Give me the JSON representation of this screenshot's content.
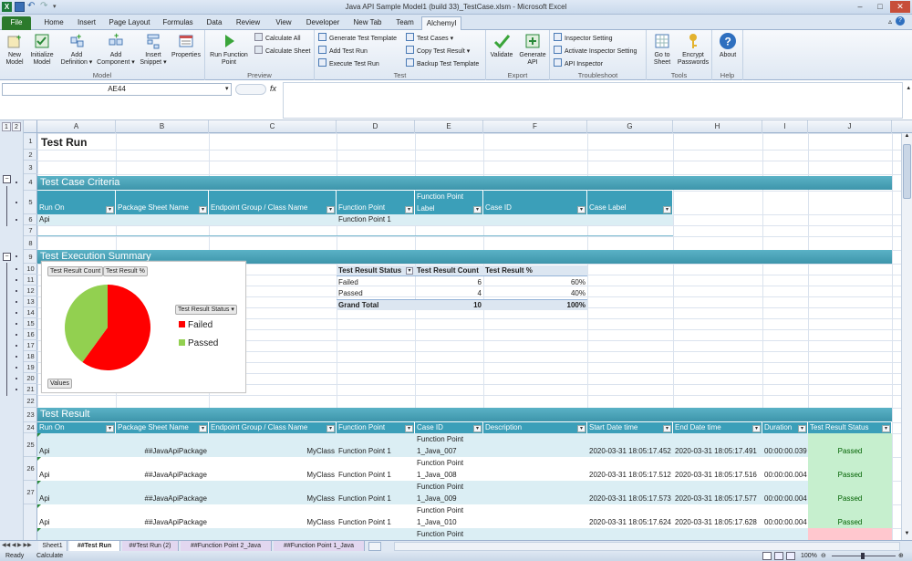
{
  "window": {
    "title": "Java API Sample Model1 (build 33)_TestCase.xlsm - Microsoft Excel"
  },
  "tabs": [
    "File",
    "Home",
    "Insert",
    "Page Layout",
    "Formulas",
    "Data",
    "Review",
    "View",
    "Developer",
    "New Tab",
    "Team",
    "Alchemyl"
  ],
  "ribbon": {
    "model_group": "Model",
    "preview_group": "Preview",
    "test_group": "Test",
    "export_group": "Export",
    "troubleshoot_group": "Troubleshoot",
    "tools_group": "Tools",
    "help_group": "Help",
    "new_model": "New Model",
    "initialize_model": "Initialize Model",
    "add_definition": "Add Definition ▾",
    "add_component": "Add Component ▾",
    "insert_snippet": "Insert Snippet ▾",
    "properties": "Properties",
    "run_function_point": "Run Function Point",
    "calculate_all": "Calculate All",
    "calculate_sheet": "Calculate Sheet",
    "generate_test_template": "Generate Test Template",
    "add_test_run": "Add Test Run",
    "execute_test_run": "Execute Test Run",
    "test_cases": "Test Cases ▾",
    "copy_test_result": "Copy Test Result ▾",
    "backup_test_template": "Backup Test Template",
    "validate": "Validate",
    "generate_api": "Generate API",
    "inspector_setting": "Inspector Setting",
    "activate_inspector_setting": "Activate Inspector Setting",
    "api_inspector": "API Inspector",
    "go_to_sheet": "Go to Sheet",
    "encrypt_passwords": "Encrypt Passwords",
    "about": "About"
  },
  "formula_bar": {
    "name_box": "AE44",
    "fx": "fx",
    "value": ""
  },
  "outline_levels": [
    "1",
    "2"
  ],
  "columns": [
    "A",
    "B",
    "C",
    "D",
    "E",
    "F",
    "G",
    "H",
    "I",
    "J"
  ],
  "rows": [
    "1",
    "2",
    "3",
    "4",
    "5",
    "6",
    "7",
    "8",
    "9",
    "10",
    "11",
    "12",
    "13",
    "14",
    "15",
    "16",
    "17",
    "18",
    "19",
    "20",
    "21",
    "22",
    "23",
    "24",
    "25",
    "26",
    "27"
  ],
  "sheet": {
    "title": "Test Run",
    "criteria_band": "Test Case Criteria",
    "criteria_headers": [
      "Run On",
      "Package Sheet Name",
      "Endpoint Group / Class Name",
      "Function Point",
      "Function Point Label",
      "Case ID",
      "Case Label"
    ],
    "criteria_row": [
      "Api",
      "",
      "",
      "Function Point 1",
      "",
      "",
      ""
    ],
    "summary_band": "Test Execution Summary",
    "pivot": {
      "headers": [
        "Test Result Status",
        "Test Result Count",
        "Test Result %"
      ],
      "rows": [
        [
          "Failed",
          "6",
          "60%"
        ],
        [
          "Passed",
          "4",
          "40%"
        ]
      ],
      "total": [
        "Grand Total",
        "10",
        "100%"
      ]
    },
    "result_band": "Test Result",
    "result_headers": [
      "Run On",
      "Package Sheet Name",
      "Endpoint Group / Class Name",
      "Function Point",
      "Case ID",
      "Description",
      "Start Date time",
      "End Date time",
      "Duration",
      "Test Result Status"
    ],
    "result_rows": [
      {
        "run_on": "Api",
        "package": "##JavaApiPackage",
        "class": "MyClass",
        "fp": "Function Point 1",
        "case_id_1": "Function Point",
        "case_id_2": "1_Java_007",
        "desc": "",
        "start": "2020-03-31 18:05:17.452",
        "end": "2020-03-31 18:05:17.491",
        "duration": "00:00:00.039",
        "status": "Passed"
      },
      {
        "run_on": "Api",
        "package": "##JavaApiPackage",
        "class": "MyClass",
        "fp": "Function Point 1",
        "case_id_1": "Function Point",
        "case_id_2": "1_Java_008",
        "desc": "",
        "start": "2020-03-31 18:05:17.512",
        "end": "2020-03-31 18:05:17.516",
        "duration": "00:00:00.004",
        "status": "Passed"
      },
      {
        "run_on": "Api",
        "package": "##JavaApiPackage",
        "class": "MyClass",
        "fp": "Function Point 1",
        "case_id_1": "Function Point",
        "case_id_2": "1_Java_009",
        "desc": "",
        "start": "2020-03-31 18:05:17.573",
        "end": "2020-03-31 18:05:17.577",
        "duration": "00:00:00.004",
        "status": "Passed"
      },
      {
        "run_on": "Api",
        "package": "##JavaApiPackage",
        "class": "MyClass",
        "fp": "Function Point 1",
        "case_id_1": "Function Point",
        "case_id_2": "1_Java_010",
        "desc": "",
        "start": "2020-03-31 18:05:17.624",
        "end": "2020-03-31 18:05:17.628",
        "duration": "00:00:00.004",
        "status": "Passed"
      }
    ],
    "partial_row_case_id": "Function Point"
  },
  "chart": {
    "field_buttons": [
      "Test Result Count",
      "Test Result %"
    ],
    "legend_field": "Test Result Status ▾",
    "values_button": "Values"
  },
  "chart_data": {
    "type": "pie",
    "categories": [
      "Failed",
      "Passed"
    ],
    "values": [
      6,
      4
    ],
    "colors": [
      "#ff0000",
      "#92d050"
    ],
    "legend": "right"
  },
  "sheet_tabs": [
    "Sheet1",
    "##Test Run",
    "##Test Run (2)",
    "##Function Point 2_Java",
    "##Function Point 1_Java"
  ],
  "status": {
    "left1": "Ready",
    "left2": "Calculate",
    "zoom": "100%"
  }
}
